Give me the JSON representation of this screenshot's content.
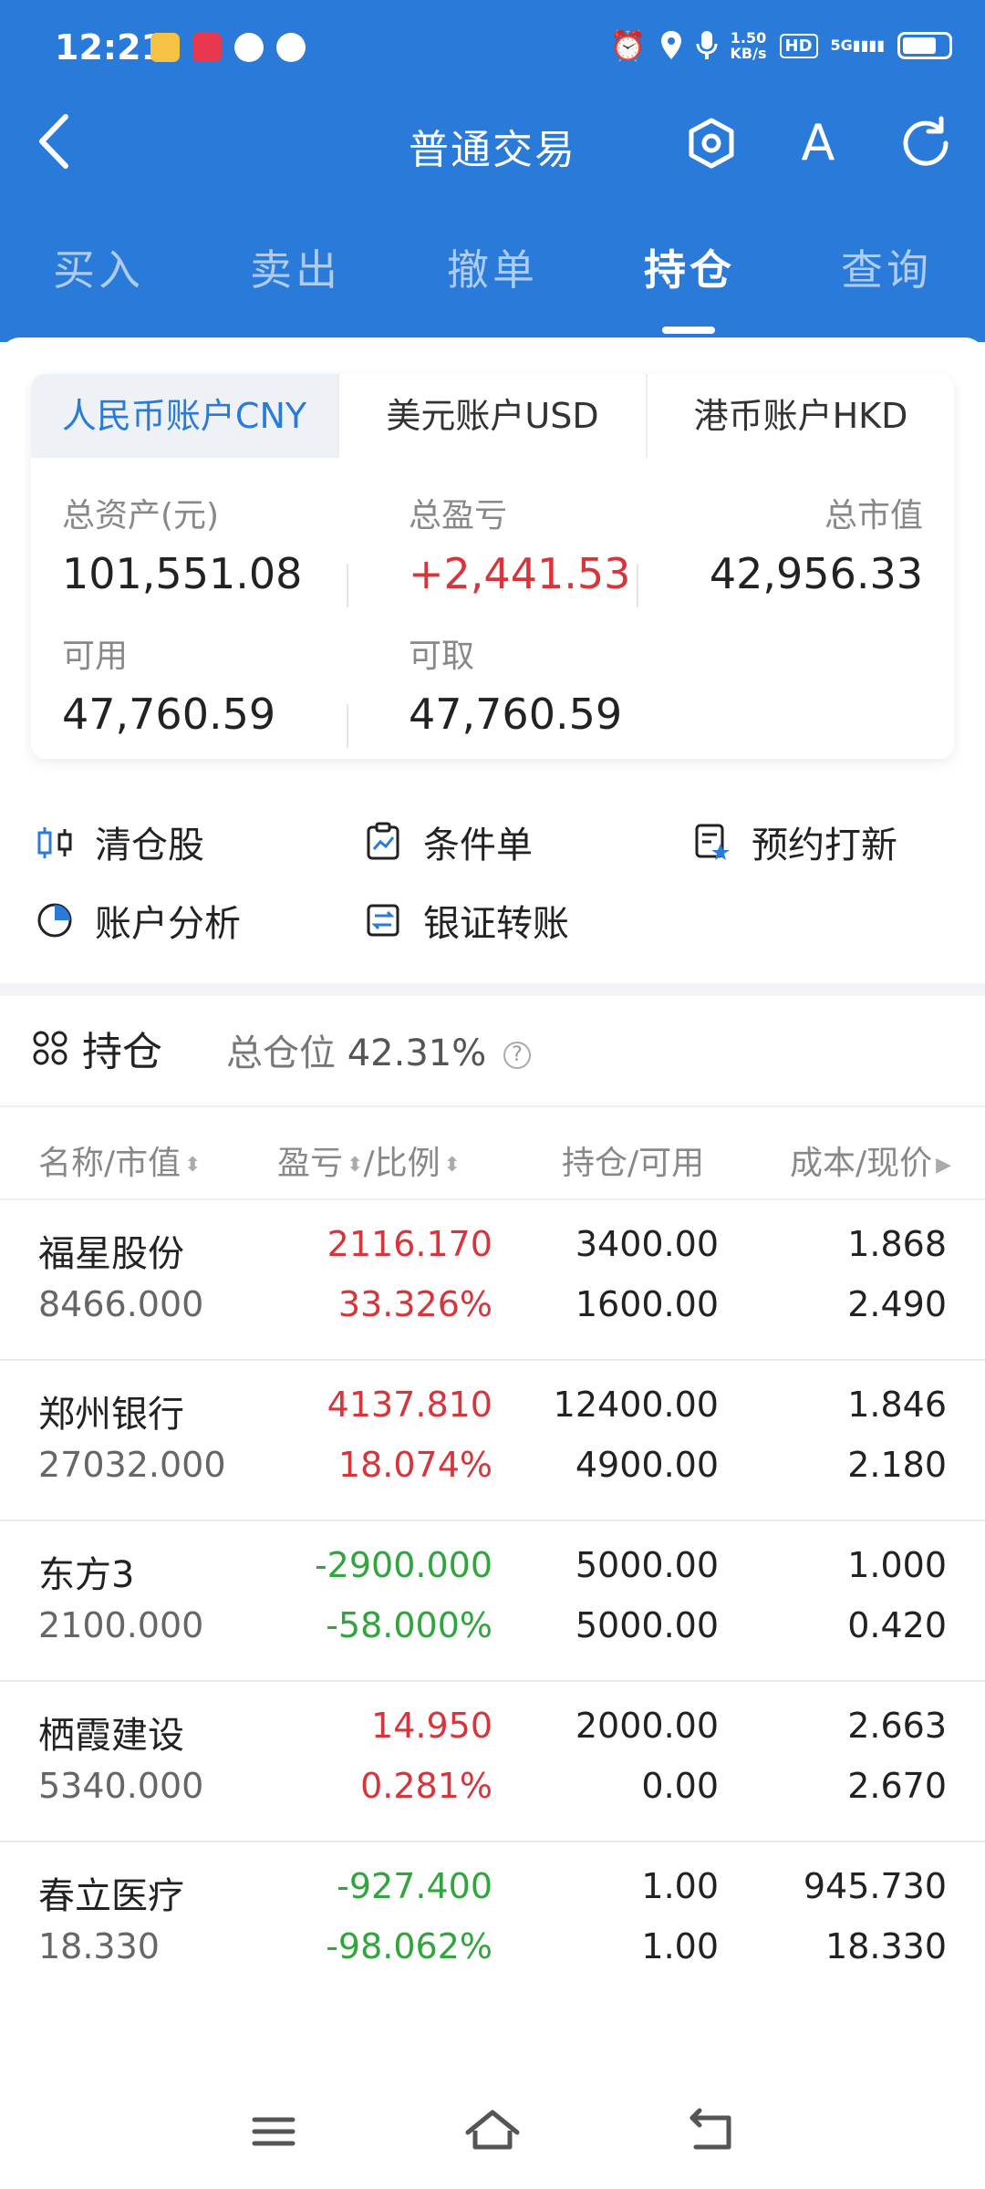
{
  "status_bar": {
    "time": "12:21",
    "net_speed_value": "1.50",
    "net_speed_unit": "KB/s",
    "hd_label": "HD",
    "signal_label": "5G"
  },
  "nav": {
    "title": "普通交易",
    "font_icon_glyph": "A"
  },
  "tabs": [
    {
      "label": "买入"
    },
    {
      "label": "卖出"
    },
    {
      "label": "撤单"
    },
    {
      "label": "持仓"
    },
    {
      "label": "查询"
    }
  ],
  "active_tab": "持仓",
  "account_tabs": [
    {
      "label": "人民币账户CNY"
    },
    {
      "label": "美元账户USD"
    },
    {
      "label": "港币账户HKD"
    }
  ],
  "summary": {
    "total_assets_label": "总资产(元)",
    "total_assets": "101,551.08",
    "total_pl_label": "总盈亏",
    "total_pl": "+2,441.53",
    "total_market_value_label": "总市值",
    "total_market_value": "42,956.33",
    "available_label": "可用",
    "available": "47,760.59",
    "withdrawable_label": "可取",
    "withdrawable": "47,760.59"
  },
  "quick_actions": [
    {
      "label": "清仓股",
      "icon": "clear-position-icon"
    },
    {
      "label": "条件单",
      "icon": "condition-order-icon"
    },
    {
      "label": "预约打新",
      "icon": "ipo-reserve-icon"
    },
    {
      "label": "账户分析",
      "icon": "pie-chart-icon"
    },
    {
      "label": "银证转账",
      "icon": "transfer-icon"
    }
  ],
  "holdings": {
    "title": "持仓",
    "total_position_label": "总仓位",
    "total_position": "42.31%",
    "help_glyph": "?",
    "columns": {
      "name": "名称/市值",
      "pl": "盈亏",
      "ratio": "/比例",
      "position": "持仓/可用",
      "cost": "成本/现价"
    },
    "rows": [
      {
        "name": "福星股份",
        "market_value": "8466.000",
        "pl": "2116.170",
        "ratio": "33.326%",
        "position": "3400.00",
        "available": "1600.00",
        "cost": "1.868",
        "price": "2.490",
        "trend": "up"
      },
      {
        "name": "郑州银行",
        "market_value": "27032.000",
        "pl": "4137.810",
        "ratio": "18.074%",
        "position": "12400.00",
        "available": "4900.00",
        "cost": "1.846",
        "price": "2.180",
        "trend": "up"
      },
      {
        "name": "东方3",
        "market_value": "2100.000",
        "pl": "-2900.000",
        "ratio": "-58.000%",
        "position": "5000.00",
        "available": "5000.00",
        "cost": "1.000",
        "price": "0.420",
        "trend": "down"
      },
      {
        "name": "栖霞建设",
        "market_value": "5340.000",
        "pl": "14.950",
        "ratio": "0.281%",
        "position": "2000.00",
        "available": "0.00",
        "cost": "2.663",
        "price": "2.670",
        "trend": "up"
      },
      {
        "name": "春立医疗",
        "market_value": "18.330",
        "pl": "-927.400",
        "ratio": "-98.062%",
        "position": "1.00",
        "available": "1.00",
        "cost": "945.730",
        "price": "18.330",
        "trend": "down"
      }
    ]
  },
  "colors": {
    "brand_blue": "#2a7ad9",
    "gain_red": "#d8343a",
    "loss_green": "#31a53d"
  }
}
